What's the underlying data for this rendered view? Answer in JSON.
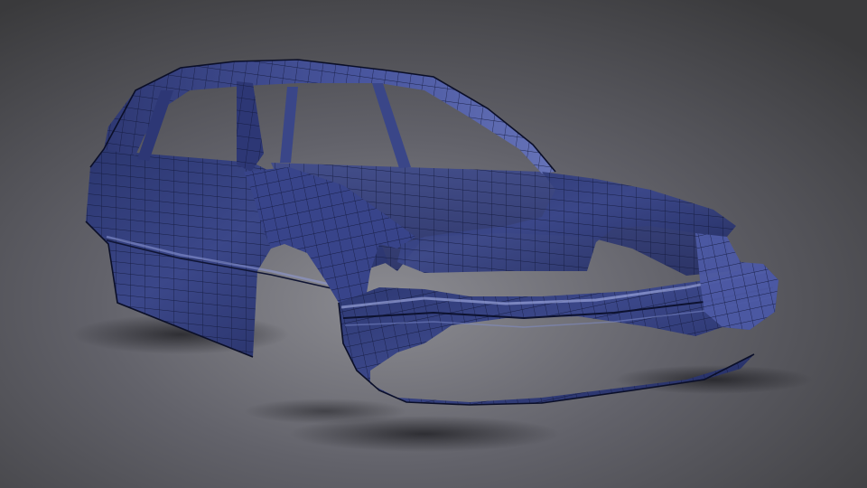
{
  "scene": {
    "subject": "car-body-wireframe-render",
    "colors": {
      "background_top": "#3a3a3c",
      "background_bottom": "#5c5c60",
      "floor_highlight": "#8e8e96",
      "body_fill": "#34407e",
      "body_fill_light": "#5a67a8",
      "body_fill_dark": "#1f2757",
      "wire": "#12183a",
      "shadow": "#1a1a1e"
    }
  }
}
